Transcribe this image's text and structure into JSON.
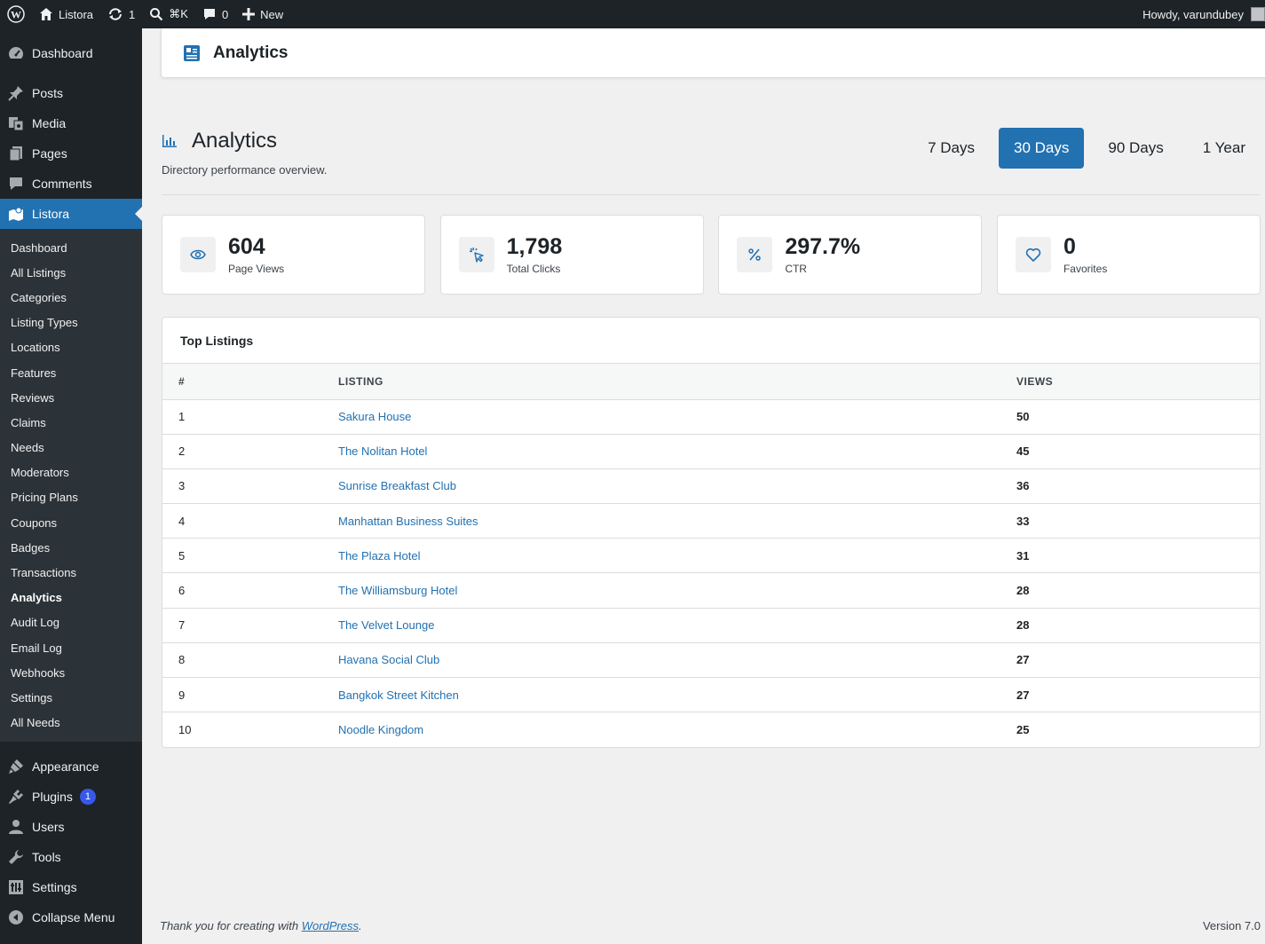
{
  "admin_bar": {
    "site_name": "Listora",
    "updates_count": "1",
    "search_shortcut": "⌘K",
    "comments_count": "0",
    "new_label": "New",
    "greeting": "Howdy, varundubey"
  },
  "sidebar": {
    "top_items": [
      {
        "label": "Dashboard",
        "icon": "dashboard-icon"
      },
      {
        "label": "Posts",
        "icon": "pin-icon"
      },
      {
        "label": "Media",
        "icon": "media-icon"
      },
      {
        "label": "Pages",
        "icon": "pages-icon"
      },
      {
        "label": "Comments",
        "icon": "comment-icon"
      },
      {
        "label": "Listora",
        "icon": "map-icon"
      }
    ],
    "sub_items": [
      "Dashboard",
      "All Listings",
      "Categories",
      "Listing Types",
      "Locations",
      "Features",
      "Reviews",
      "Claims",
      "Needs",
      "Moderators",
      "Pricing Plans",
      "Coupons",
      "Badges",
      "Transactions",
      "Analytics",
      "Audit Log",
      "Email Log",
      "Webhooks",
      "Settings",
      "All Needs"
    ],
    "bottom_items": [
      {
        "label": "Appearance",
        "icon": "brush-icon"
      },
      {
        "label": "Plugins",
        "icon": "plugin-icon",
        "badge": "1"
      },
      {
        "label": "Users",
        "icon": "user-icon"
      },
      {
        "label": "Tools",
        "icon": "wrench-icon"
      },
      {
        "label": "Settings",
        "icon": "settings-icon"
      },
      {
        "label": "Collapse Menu",
        "icon": "collapse-icon"
      }
    ]
  },
  "header": {
    "title": "Analytics"
  },
  "page": {
    "title": "Analytics",
    "subtitle": "Directory performance overview.",
    "ranges": [
      "7 Days",
      "30 Days",
      "90 Days",
      "1 Year"
    ],
    "active_range": "30 Days"
  },
  "stats": [
    {
      "value": "604",
      "label": "Page Views",
      "icon": "eye-icon"
    },
    {
      "value": "1,798",
      "label": "Total Clicks",
      "icon": "cursor-click-icon"
    },
    {
      "value": "297.7%",
      "label": "CTR",
      "icon": "percent-icon"
    },
    {
      "value": "0",
      "label": "Favorites",
      "icon": "heart-icon"
    }
  ],
  "top_listings": {
    "title": "Top Listings",
    "columns": [
      "#",
      "LISTING",
      "VIEWS"
    ],
    "rows": [
      {
        "rank": "1",
        "name": "Sakura House",
        "views": "50"
      },
      {
        "rank": "2",
        "name": "The Nolitan Hotel",
        "views": "45"
      },
      {
        "rank": "3",
        "name": "Sunrise Breakfast Club",
        "views": "36"
      },
      {
        "rank": "4",
        "name": "Manhattan Business Suites",
        "views": "33"
      },
      {
        "rank": "5",
        "name": "The Plaza Hotel",
        "views": "31"
      },
      {
        "rank": "6",
        "name": "The Williamsburg Hotel",
        "views": "28"
      },
      {
        "rank": "7",
        "name": "The Velvet Lounge",
        "views": "28"
      },
      {
        "rank": "8",
        "name": "Havana Social Club",
        "views": "27"
      },
      {
        "rank": "9",
        "name": "Bangkok Street Kitchen",
        "views": "27"
      },
      {
        "rank": "10",
        "name": "Noodle Kingdom",
        "views": "25"
      }
    ]
  },
  "footer": {
    "thanks_prefix": "Thank you for creating with ",
    "thanks_link": "WordPress",
    "thanks_suffix": ".",
    "version": "Version 7.0"
  },
  "colors": {
    "accent": "#2271b1",
    "sidebar_bg": "#1d2327",
    "submenu_bg": "#2c3338"
  }
}
